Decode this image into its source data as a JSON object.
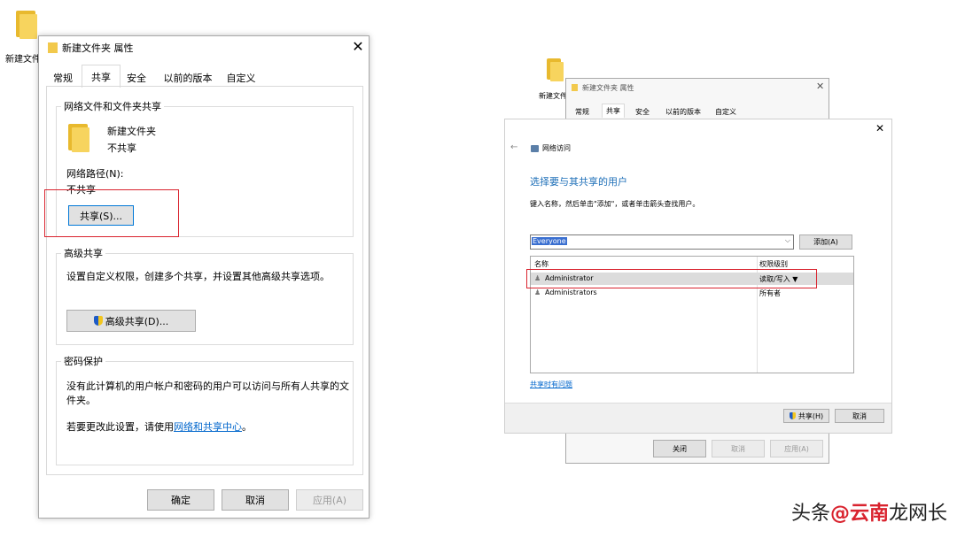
{
  "desktop": {
    "left_folder_label": "新建文件",
    "right_folder_label": "新建文件"
  },
  "left_dialog": {
    "title": "新建文件夹 属性",
    "tabs": [
      "常规",
      "共享",
      "安全",
      "以前的版本",
      "自定义"
    ],
    "network_group": {
      "title": "网络文件和文件夹共享",
      "folder_name": "新建文件夹",
      "share_state": "不共享",
      "path_label": "网络路径(N):",
      "path_value": "不共享",
      "share_button": "共享(S)..."
    },
    "advanced_group": {
      "title": "高级共享",
      "description": "设置自定义权限，创建多个共享，并设置其他高级共享选项。",
      "button": "高级共享(D)..."
    },
    "password_group": {
      "title": "密码保护",
      "text_line1": "没有此计算机的用户帐户和密码的用户可以访问与所有人共享的文",
      "text_line2": "件夹。",
      "change_prefix": "若要更改此设置，请使用",
      "change_link": "网络和共享中心",
      "change_suffix": "。"
    },
    "footer": {
      "ok": "确定",
      "cancel": "取消",
      "apply": "应用(A)"
    }
  },
  "bg_dialog": {
    "title": "新建文件夹 属性",
    "tabs": [
      "常规",
      "共享",
      "安全",
      "以前的版本",
      "自定义"
    ],
    "footer": {
      "close": "关闭",
      "cancel": "取消",
      "apply": "应用(A)"
    }
  },
  "network_access": {
    "title": "网络访问",
    "heading": "选择要与其共享的用户",
    "instruction": "键入名称，然后单击\"添加\"，或者单击箭头查找用户。",
    "combo_value": "Everyone",
    "add_button": "添加(A)",
    "columns": [
      "名称",
      "权限级别"
    ],
    "rows": [
      {
        "name": "Administrator",
        "level": "读取/写入 ▼"
      },
      {
        "name": "Administrators",
        "level": "所有者"
      }
    ],
    "trouble_link": "共享时有问题",
    "share_button": "共享(H)",
    "cancel_button": "取消"
  },
  "watermark": {
    "text1": "头条",
    "text2": "@云南",
    "text3": "龙网长"
  },
  "colors": {
    "accent": "#0066cc",
    "highlight": "#d9232e",
    "heading": "#1e6fb8"
  }
}
